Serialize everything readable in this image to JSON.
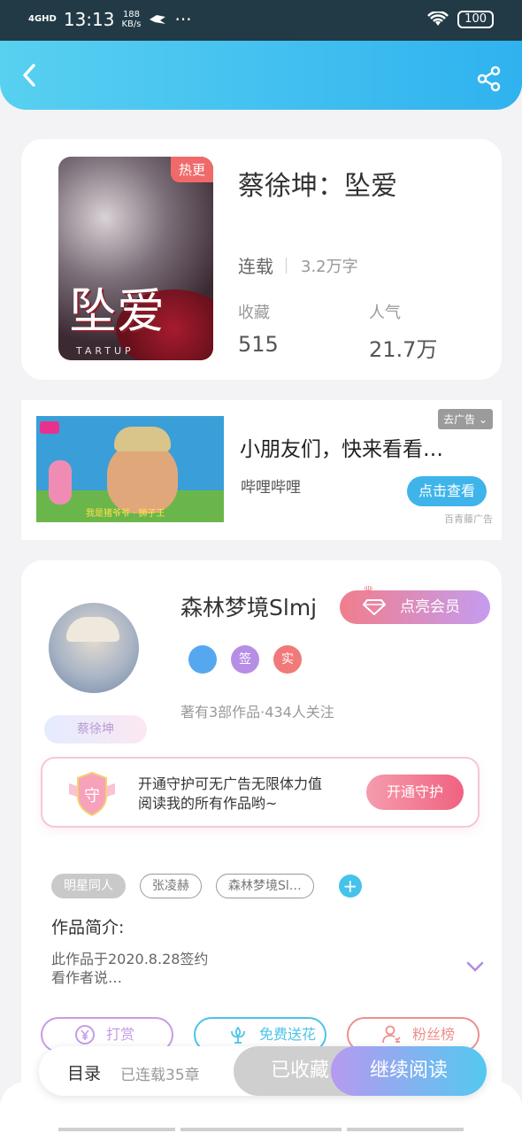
{
  "status_bar": {
    "network": "4GHD",
    "time": "13:13",
    "speed_value": "188",
    "speed_unit": "KB/s",
    "more": "···",
    "battery": "100"
  },
  "header": {
    "back_icon": "back-arrow-icon",
    "share_icon": "share-icon",
    "gradient_colors": [
      "#58d0f0",
      "#2fb2ef"
    ]
  },
  "book": {
    "cover_badge": "热更",
    "cover_art_text": "坠爱",
    "cover_art_bottom": "TARTUP",
    "title": "蔡徐坤：坠爱",
    "status": "连载",
    "word_count": "3.2万字",
    "stats": [
      {
        "label": "收藏",
        "value": "515"
      },
      {
        "label": "人气",
        "value": "21.7万"
      }
    ]
  },
  "ad": {
    "title": "小朋友们，快来看看…",
    "source": "哔哩哔哩",
    "button": "点击查看",
    "close_label": "去广告",
    "brand": "百青藤广告",
    "image_caption": "我是猪爷爷 · 狮子王"
  },
  "author": {
    "name": "森林梦境Slmj",
    "vip_button": "点亮会员",
    "badges": [
      {
        "icon": "phone-verified-icon",
        "text": ""
      },
      {
        "icon": "signed-icon",
        "text": "签"
      },
      {
        "icon": "real-name-icon",
        "text": "实"
      }
    ],
    "meta": "著有3部作品·434人关注",
    "fan_tag": "蔡徐坤"
  },
  "guard": {
    "text_line1": "开通守护可无广告无限体力值",
    "text_line2": "阅读我的所有作品哟~",
    "button": "开通守护",
    "shield_char": "守"
  },
  "tags": {
    "items": [
      "明星同人",
      "张凌赫",
      "森林梦境Sl…"
    ],
    "add": "+"
  },
  "intro": {
    "heading": "作品简介:",
    "line1": "此作品于2020.8.28签约",
    "line2": "看作者说…"
  },
  "actions": [
    {
      "label": "打赏",
      "icon": "yen-icon",
      "color": "#c79be8"
    },
    {
      "label": "免费送花",
      "icon": "flower-icon",
      "color": "#4cc3e8"
    },
    {
      "label": "粉丝榜",
      "icon": "fans-icon",
      "color": "#ee8f8f"
    }
  ],
  "bottom_bar": {
    "catalog": "目录",
    "chapters": "已连载35章",
    "collected": "已收藏",
    "continue": "继续阅读"
  }
}
